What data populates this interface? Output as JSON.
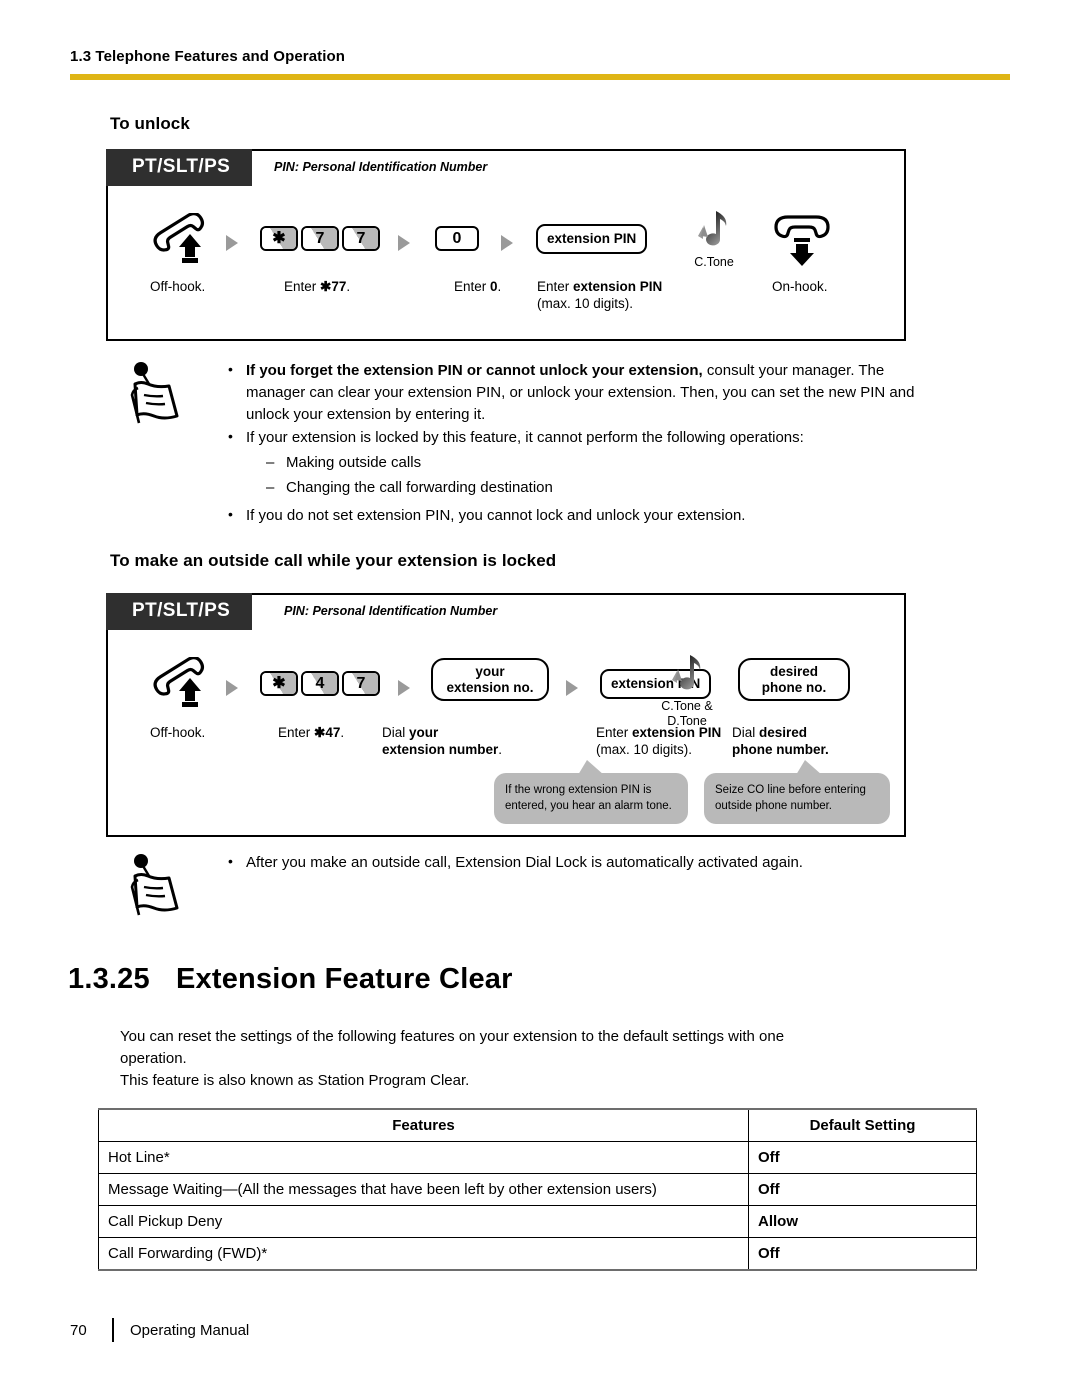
{
  "header": {
    "chapter": "1.3 Telephone Features and Operation",
    "rule_color": "#dfb515"
  },
  "section_unlock": {
    "heading": "To unlock",
    "diagram": {
      "phone_types": "PT/SLT/PS",
      "legend": "PIN: Personal Identification Number",
      "steps": [
        {
          "icon": "offhook-handset-icon",
          "caption": "Off-hook."
        },
        {
          "keys": [
            "✱",
            "7",
            "7"
          ],
          "caption_plain": "Enter ",
          "caption_bold": "✱77",
          "caption_tail": "."
        },
        {
          "keys": [
            "0"
          ],
          "caption_plain": "Enter ",
          "caption_bold": "0",
          "caption_tail": "."
        },
        {
          "pill": "extension PIN",
          "caption_plain": "Enter ",
          "caption_bold": "extension PIN",
          "caption_line2": "(max. 10 digits)."
        },
        {
          "icon": "confirmation-tone-icon",
          "tone": "C.Tone"
        },
        {
          "icon": "onhook-handset-icon",
          "caption": "On-hook."
        }
      ]
    },
    "notes": [
      {
        "bold": "If you forget the extension PIN or cannot unlock your extension,",
        "rest": " consult your manager. The manager can clear your extension PIN, or unlock your extension. Then, you can set the new PIN and unlock your extension by entering it."
      },
      {
        "bold": "",
        "rest": "If your extension is locked by this feature, it cannot perform the following operations:"
      },
      {
        "dash": true,
        "rest": "Making outside calls"
      },
      {
        "dash": true,
        "rest": "Changing the call forwarding destination"
      },
      {
        "bold": "",
        "rest": "If you do not set extension PIN, you cannot lock and unlock your extension."
      }
    ]
  },
  "section_outside_call": {
    "heading": "To make an outside call while your extension is locked",
    "diagram": {
      "phone_types": "PT/SLT/PS",
      "legend": "PIN: Personal Identification Number",
      "steps": [
        {
          "icon": "offhook-handset-icon",
          "caption": "Off-hook."
        },
        {
          "keys": [
            "✱",
            "4",
            "7"
          ],
          "caption_plain": "Enter ",
          "caption_bold": "✱47",
          "caption_tail": "."
        },
        {
          "pill_l1": "your",
          "pill_l2": "extension no.",
          "caption_plain": "Dial ",
          "caption_bold": "your",
          "caption_line2_bold": "extension number",
          "caption_line2_tail": "."
        },
        {
          "pill": "extension PIN",
          "caption_plain": "Enter ",
          "caption_bold": "extension PIN",
          "caption_line2": "(max. 10 digits)."
        },
        {
          "icon": "confirmation-tone-icon",
          "tone_l1": "C.Tone &",
          "tone_l2": "D.Tone"
        },
        {
          "pill_l1": "desired",
          "pill_l2": "phone no.",
          "caption_plain": "Dial ",
          "caption_bold": "desired",
          "caption_line2_bold": "phone number."
        }
      ],
      "bubbles": [
        {
          "l1": "If the wrong extension PIN is",
          "l2": "entered, you hear an alarm tone."
        },
        {
          "l1": "Seize CO line before entering",
          "l2": "outside phone number."
        }
      ]
    },
    "notes": [
      {
        "bold": "",
        "rest": "After you make an outside call, Extension Dial Lock is automatically activated again."
      }
    ]
  },
  "section_feature_clear": {
    "number": "1.3.25",
    "title": "Extension Feature Clear",
    "para_line1": "You can reset the settings of the following features on your extension to the default settings with one",
    "para_line2": "operation.",
    "para_line3": "This feature is also known as Station Program Clear.",
    "table": {
      "columns": [
        "Features",
        "Default Setting"
      ],
      "rows": [
        [
          "Hot Line*",
          "Off"
        ],
        [
          "Message Waiting—(All the messages that have been left by other extension users)",
          "Off"
        ],
        [
          "Call Pickup Deny",
          "Allow"
        ],
        [
          "Call Forwarding (FWD)*",
          "Off"
        ]
      ]
    }
  },
  "footer": {
    "page_number": "70",
    "label": "Operating Manual"
  }
}
